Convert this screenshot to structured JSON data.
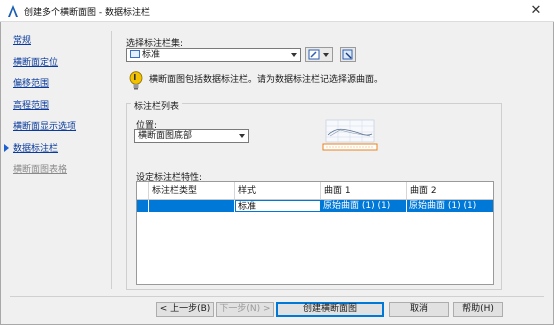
{
  "window": {
    "title": "创建多个横断面图 - 数据标注栏",
    "close_glyph": "✕"
  },
  "nav": {
    "items": [
      {
        "label": "常规",
        "state": "link"
      },
      {
        "label": "横断面定位",
        "state": "link"
      },
      {
        "label": "偏移范围",
        "state": "link"
      },
      {
        "label": "高程范围",
        "state": "link"
      },
      {
        "label": "横断面显示选项",
        "state": "link"
      },
      {
        "label": "数据标注栏",
        "state": "active"
      },
      {
        "label": "横断面图表格",
        "state": "disabled"
      }
    ]
  },
  "band_set": {
    "label": "选择标注栏集:",
    "value": "标准"
  },
  "info": {
    "message": "横断面图包括数据标注栏。请为数据标注栏记选择源曲面。"
  },
  "band_list": {
    "group_title": "标注栏列表",
    "location_label": "位置:",
    "location_value": "横断面图底部",
    "properties_label": "设定标注栏特性:",
    "columns": [
      "标注栏类型",
      "样式",
      "曲面 1",
      "曲面 2"
    ],
    "rows": [
      {
        "type": "",
        "style": "标准",
        "surface1": "原始曲面 (1) (1)",
        "surface2": "原始曲面 (1) (1)"
      }
    ]
  },
  "buttons": {
    "prev": "< 上一步(B)",
    "next": "下一步(N) >",
    "create": "创建横断面图",
    "cancel": "取消",
    "help": "帮助(H)"
  },
  "colors": {
    "link": "#0a3b9c",
    "accent": "#0078d7",
    "warning": "#f2c200",
    "preview_highlight": "#e8821e"
  }
}
